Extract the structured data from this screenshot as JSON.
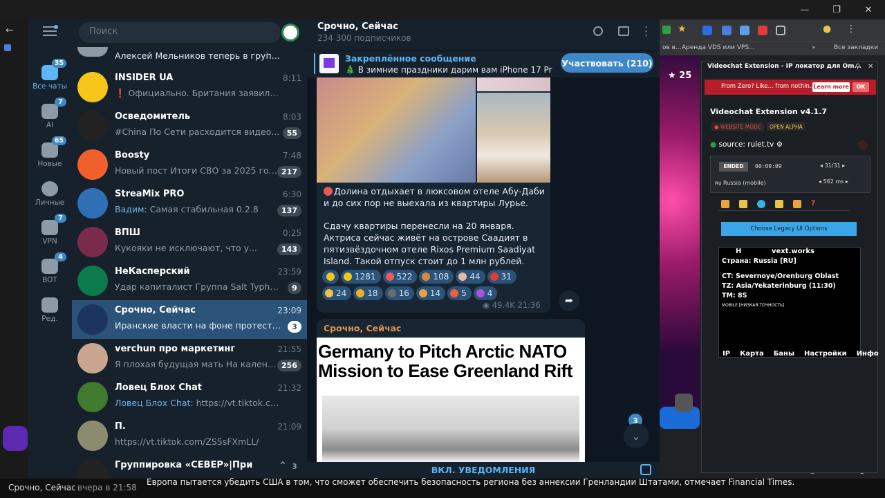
{
  "telegram": {
    "search_placeholder": "Поиск",
    "rail": [
      {
        "label": "Все чаты",
        "badge": "35"
      },
      {
        "label": "AI",
        "badge": "7"
      },
      {
        "label": "Новые",
        "badge": "65"
      },
      {
        "label": "Личные",
        "badge": ""
      },
      {
        "label": "VPN",
        "badge": "7"
      },
      {
        "label": "BOT",
        "badge": "4"
      },
      {
        "label": "Ред.",
        "badge": ""
      }
    ],
    "top_partial": "Алексей Мельников теперь в группе",
    "chats": [
      {
        "title": "INSIDER UA",
        "time": "8:11",
        "preview": "❗ Официально. Британия заявила в воскре...",
        "badge": "",
        "color": "#f5c518"
      },
      {
        "title": "Осведомитель",
        "time": "8:03",
        "preview": "#China По Сети расходится видео...",
        "badge": "55",
        "color": "#222"
      },
      {
        "title": "Boosty",
        "time": "7:48",
        "preview": "Новый пост Итоги СВО за 2025 год на ...",
        "badge": "217",
        "color": "#f15f2c"
      },
      {
        "title": "StreaMix PRO",
        "time": "6:30",
        "sender": "Вадим:",
        "preview": " Самая стабильная 0.2.8",
        "badge": "137",
        "color": "#2f6fb5"
      },
      {
        "title": "ВПШ",
        "time": "0:25",
        "preview": "Кукояки не исключают, что у...",
        "badge": "143",
        "color": "#7a2a4a"
      },
      {
        "title": "НеКасперский",
        "time": "23:59",
        "preview": "Удар капиталист  Группа Salt Typhoon, с...",
        "badge": "9",
        "color": "#0c7a4a"
      },
      {
        "title": "Срочно, Сейчас",
        "time": "23:09",
        "preview": "Иранские власти на фоне протестов ...",
        "badge": "3",
        "color": "#1b3560"
      },
      {
        "title": "verchun про маркетинг",
        "time": "21:55",
        "preview": "Я плохая будущая мать   На календ...",
        "badge": "256",
        "color": "#c9a48e"
      },
      {
        "title": "Ловец Блох Chat",
        "time": "21:32",
        "sender": "Ловец Блох Chat:",
        "preview": " https://vt.tiktok.com/ZS...",
        "badge": "",
        "color": "#3f7a2f"
      },
      {
        "title": "П.",
        "time": "21:09",
        "preview": "https://vt.tiktok.com/ZS5sFXmLL/",
        "badge": "",
        "color": "#8b8b70"
      },
      {
        "title": "Группировка «СЕВЕР»|Приграничн...",
        "time": "",
        "preview": "",
        "badge": "3",
        "color": "#222"
      }
    ],
    "channel": {
      "title": "Срочно, Сейчас",
      "subscribers": "234 300 подписчиков",
      "pinned_title": "Закреплённое сообщение",
      "pinned_text": "🎄 В зимние праздники дарим вам iPhone 17 Pro ...",
      "join_label": "Участвовать (210)",
      "post_text_1": "Долина отдыхает в люксовом отеле Абу-Даби и до сих пор не выехала из квартиры Лурье.",
      "post_text_2": "Сдачу квартиры перенесли на 20 января. Актриса сейчас живёт на острове Саадият в пятизвёздочном отеле Rixos Premium Saadiyat Island. Такой отпуск стоит до 1 млн рублей.",
      "reactions": [
        "1281",
        "522",
        "108",
        "44",
        "31",
        "24",
        "18",
        "16",
        "14",
        "5",
        "4"
      ],
      "views": "49.4K",
      "post_time": "21:36",
      "next_author": "Срочно, Сейчас",
      "headline": "Germany to Pitch Arctic NATO Mission to Ease Greenland Rift",
      "unread_badge": "3",
      "unmute_label": "ВКЛ. УВЕДОМЛЕНИЯ"
    }
  },
  "browser": {
    "bookmarks": [
      "Аренда VDS или VPS...",
      "Все закладки"
    ],
    "counter": "25",
    "ext": {
      "banner": "From Zero? Like... from nothin...",
      "learn_more": "Learn more",
      "ok": "OK",
      "header": "Videochat Extension - IP локатор для Om...",
      "version": "Videochat Extension v4.1.7",
      "mode1": "WEBSITE MODE",
      "mode2": "OPEN ALPHA",
      "source": "source: rulet.tv",
      "status": "ENDED",
      "timer": "00:00:09",
      "count": "31/31",
      "country": "Russia (mobile)",
      "ms": "562 ms",
      "legacy_btn": "Choose Legacy UI Options",
      "site": "vext.works",
      "country_line": "Страна: Russia [RU]",
      "ct": "CT: Severnoye/Orenburg Oblast",
      "tz": "TZ: Asia/Yekaterinburg (11:30)",
      "tm": "TM: 8S",
      "mobile": "MOBILE [НИЗКАЯ ТОЧНОСТЬ]",
      "tabs": [
        "IP",
        "Карта",
        "Баны",
        "Настройки",
        "Инфо"
      ]
    }
  },
  "taskbar": {
    "app": "Срочно, Сейчас",
    "time": "вчера в 21:58",
    "ticker": "Европа пытается убедить США в том, что сможет обеспечить безопасность региона без аннексии Гренландии Штатами, отмечает Financial Times."
  }
}
